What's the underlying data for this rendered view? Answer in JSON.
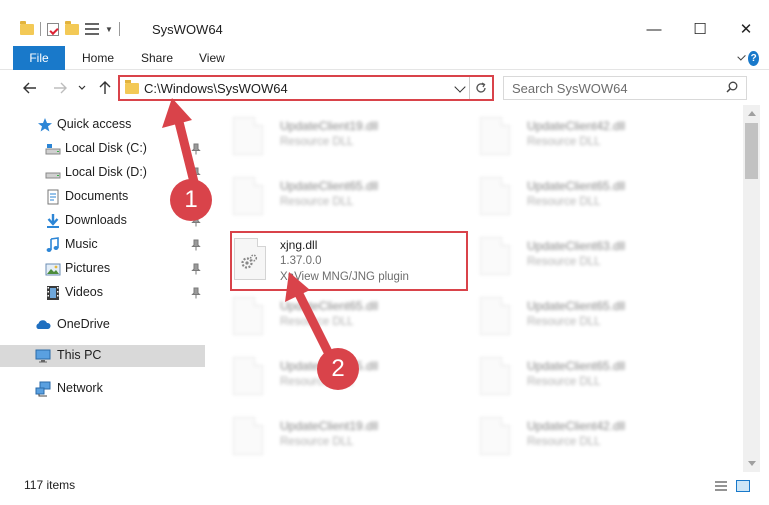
{
  "window": {
    "title": "SysWOW64",
    "minimize_glyph": "—",
    "maximize_glyph": "☐",
    "close_glyph": "✕"
  },
  "ribbon": {
    "tabs": [
      "File",
      "Home",
      "Share",
      "View"
    ]
  },
  "navigation": {
    "address_path": "C:\\Windows\\SysWOW64",
    "search_placeholder": "Search SysWOW64"
  },
  "sidebar": {
    "items": [
      {
        "label": "Quick access",
        "icon": "star-icon"
      },
      {
        "label": "Local Disk (C:)",
        "icon": "drive-icon",
        "pinned": true
      },
      {
        "label": "Local Disk (D:)",
        "icon": "drive-icon",
        "pinned": true
      },
      {
        "label": "Documents",
        "icon": "documents-icon",
        "pinned": true
      },
      {
        "label": "Downloads",
        "icon": "downloads-icon",
        "pinned": true
      },
      {
        "label": "Music",
        "icon": "music-icon",
        "pinned": true
      },
      {
        "label": "Pictures",
        "icon": "pictures-icon",
        "pinned": true
      },
      {
        "label": "Videos",
        "icon": "videos-icon",
        "pinned": true
      },
      {
        "label": "OneDrive",
        "icon": "onedrive-icon"
      },
      {
        "label": "This PC",
        "icon": "this-pc-icon",
        "selected": true
      },
      {
        "label": "Network",
        "icon": "network-icon"
      }
    ]
  },
  "files": [
    {
      "name": "UpdateClient19.dll",
      "desc": "Resource DLL",
      "blurred": true
    },
    {
      "name": "UpdateClient42.dll",
      "desc": "Resource DLL",
      "blurred": true
    },
    {
      "name": "UpdateClient65.dll",
      "desc": "Resource DLL",
      "blurred": true
    },
    {
      "name": "UpdateClient65.dll",
      "desc": "Resource DLL",
      "blurred": true
    },
    {
      "name": "xjng.dll",
      "version": "1.37.0.0",
      "desc": "XnView MNG/JNG plugin",
      "blurred": false,
      "highlighted": true
    },
    {
      "name": "UpdateClient63.dll",
      "desc": "Resource DLL",
      "blurred": true
    },
    {
      "name": "UpdateClient65.dll",
      "desc": "Resource DLL",
      "blurred": true
    },
    {
      "name": "UpdateClient65.dll",
      "desc": "Resource DLL",
      "blurred": true
    },
    {
      "name": "UpdateClient65.dll",
      "desc": "Resource DLL",
      "blurred": true
    },
    {
      "name": "UpdateClient65.dll",
      "desc": "Resource DLL",
      "blurred": true
    },
    {
      "name": "UpdateClient19.dll",
      "desc": "Resource DLL",
      "blurred": true
    },
    {
      "name": "UpdateClient42.dll",
      "desc": "Resource DLL",
      "blurred": true
    }
  ],
  "status": {
    "item_count": "117 items"
  },
  "annotations": {
    "step1": "1",
    "step2": "2",
    "color": "#d9434a"
  },
  "colors": {
    "accent": "#1979ca",
    "highlight_border": "#d9434a"
  }
}
